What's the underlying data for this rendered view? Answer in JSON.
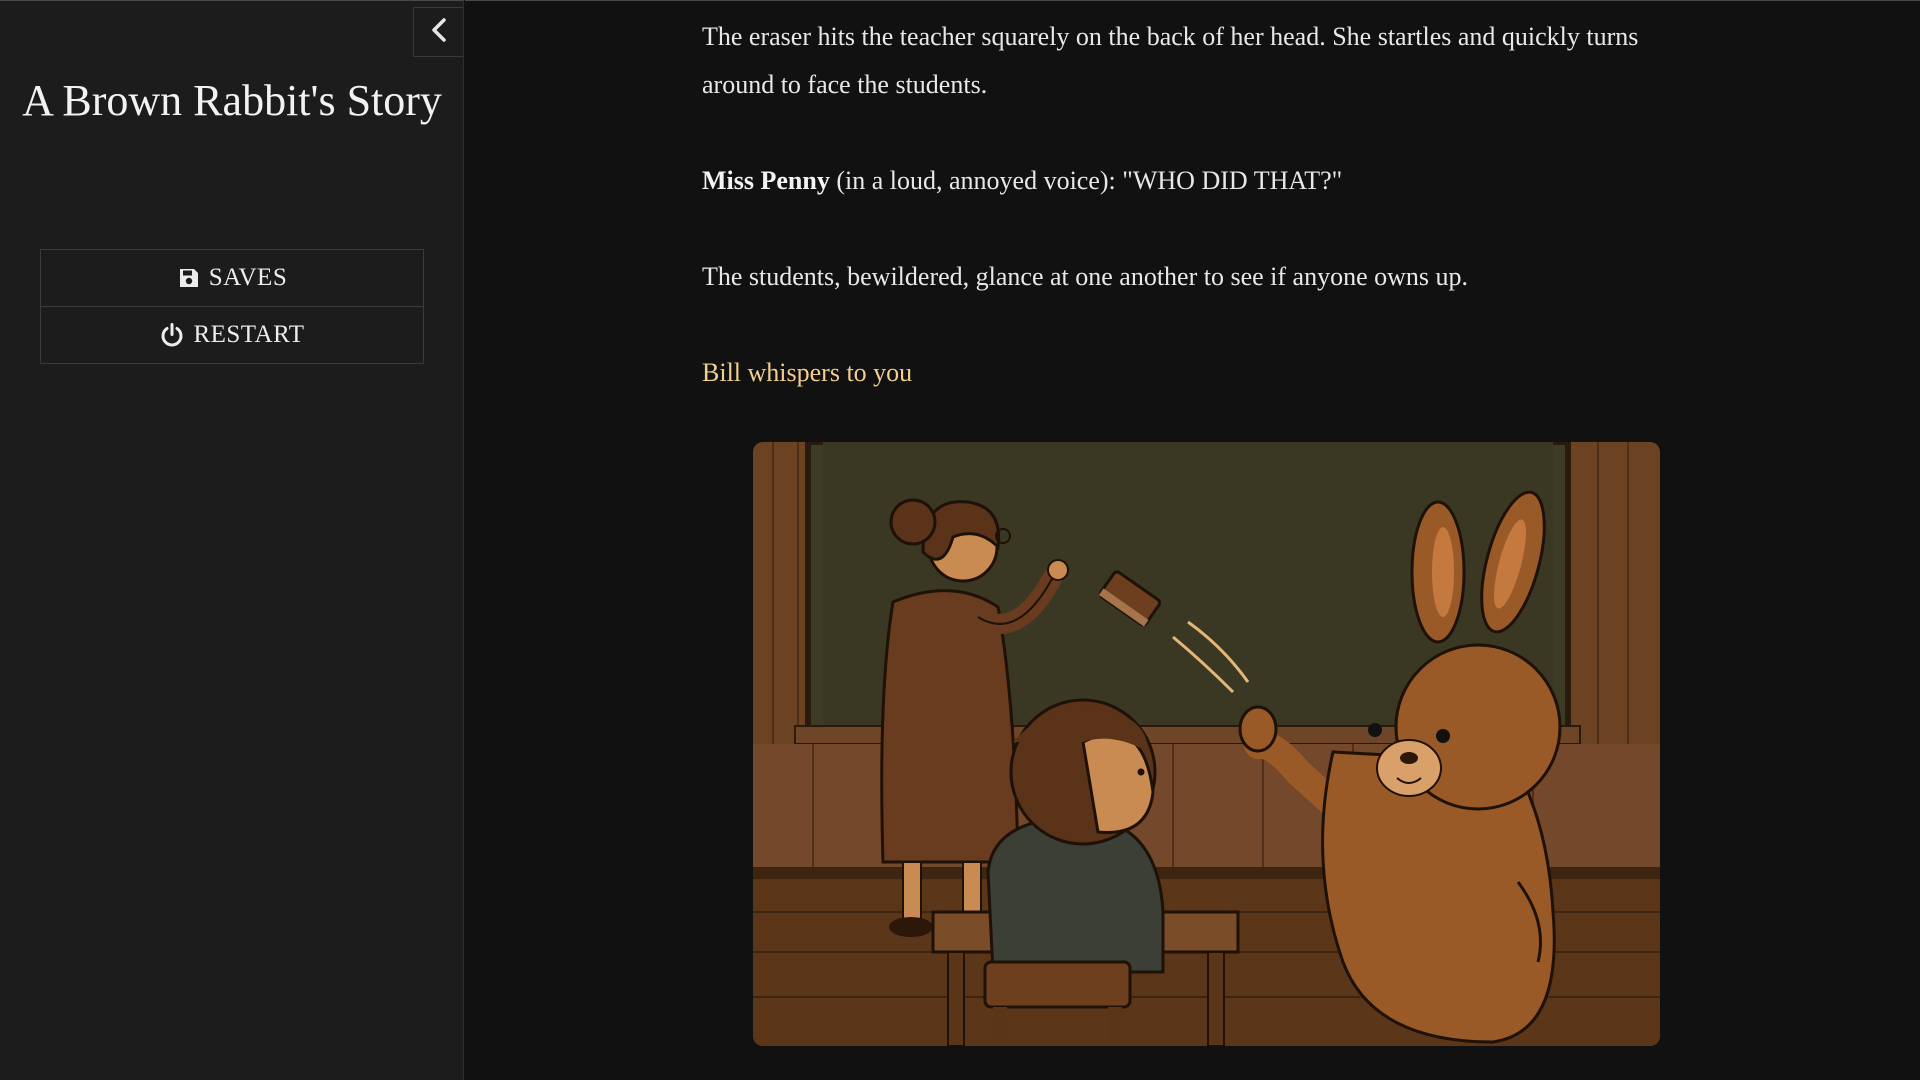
{
  "sidebar": {
    "title": "A Brown Rabbit's Story",
    "toggle_icon": "chevron-left-icon",
    "menu": [
      {
        "label": "SAVES",
        "icon": "floppy-disk-icon"
      },
      {
        "label": "RESTART",
        "icon": "power-icon"
      }
    ]
  },
  "passage": {
    "p1": "The eraser hits the teacher squarely on the back of her head. She startles and quickly turns around to face the students.",
    "p2_speaker": "Miss Penny",
    "p2_text": " (in a loud, annoyed voice): \"WHO DID THAT?\"",
    "p3": "The students, bewildered, glance at one another to see if anyone owns up.",
    "link": "Bill whispers to you"
  },
  "colors": {
    "background": "#111111",
    "sidebar": "#1c1c1c",
    "link": "#f3cf8e",
    "text": "#e8e8e8"
  }
}
